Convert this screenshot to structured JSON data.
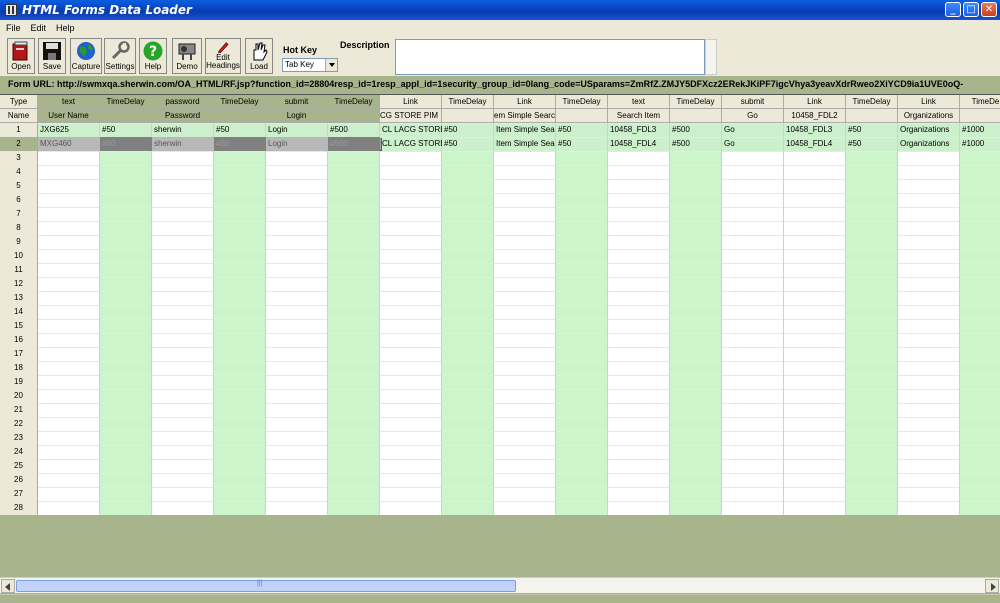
{
  "window": {
    "title": "HTML Forms Data Loader"
  },
  "menu": [
    "File",
    "Edit",
    "Help"
  ],
  "toolbar": {
    "buttons": [
      {
        "label": "Open",
        "icon": "open-book-icon"
      },
      {
        "label": "Save",
        "icon": "floppy-disk-icon"
      },
      {
        "label": "Capture",
        "icon": "globe-icon"
      },
      {
        "label": "Settings",
        "icon": "wrench-icon"
      },
      {
        "label": "Help",
        "icon": "question-icon"
      },
      {
        "label": "Demo",
        "icon": "projector-icon"
      },
      {
        "label": "Edit Headings",
        "icon": "pencil-icon"
      },
      {
        "label": "Load",
        "icon": "hand-icon"
      }
    ],
    "hotkey_label": "Hot Key",
    "hotkey_value": "Tab Key",
    "description_label": "Description",
    "description_value": ""
  },
  "form_url": "Form URL: http://swmxqa.sherwin.com/OA_HTML/RF.jsp?function_id=28804resp_id=1resp_appl_id=1security_group_id=0lang_code=USparams=ZmRfZ.ZMJY5DFXcz2ERekJKiPF7igcVhya3yeavXdrRweo2XiYCD9ia1UVE0oQ-",
  "grid": {
    "type_header": "Type",
    "name_header": "Name",
    "columns": [
      {
        "type": "text",
        "name": "User Name",
        "cells": [
          "JXG625",
          "MXG460"
        ]
      },
      {
        "type": "TimeDelay",
        "name": "",
        "cells": [
          "#50",
          "#50"
        ]
      },
      {
        "type": "password",
        "name": "Password",
        "cells": [
          "sherwin",
          "sherwin"
        ]
      },
      {
        "type": "TimeDelay",
        "name": "",
        "cells": [
          "#50",
          "#50"
        ]
      },
      {
        "type": "submit",
        "name": "Login",
        "cells": [
          "Login",
          "Login"
        ]
      },
      {
        "type": "TimeDelay",
        "name": "",
        "cells": [
          "#500",
          "#500"
        ]
      },
      {
        "type": "Link",
        "name": "CG STORE PIM I",
        "cells": [
          "CL LACG STORE",
          "CL LACG STORE"
        ]
      },
      {
        "type": "TimeDelay",
        "name": "",
        "cells": [
          "#50",
          "#50"
        ]
      },
      {
        "type": "Link",
        "name": "em Simple Searc",
        "cells": [
          "Item Simple Sea",
          "Item Simple Sea"
        ]
      },
      {
        "type": "TimeDelay",
        "name": "",
        "cells": [
          "#50",
          "#50"
        ]
      },
      {
        "type": "text",
        "name": "Search Item",
        "cells": [
          "10458_FDL3",
          "10458_FDL4"
        ]
      },
      {
        "type": "TimeDelay",
        "name": "",
        "cells": [
          "#500",
          "#500"
        ]
      },
      {
        "type": "submit",
        "name": "Go",
        "cells": [
          "Go",
          "Go"
        ]
      },
      {
        "type": "Link",
        "name": "10458_FDL2",
        "cells": [
          "10458_FDL3",
          "10458_FDL4"
        ]
      },
      {
        "type": "TimeDelay",
        "name": "",
        "cells": [
          "#50",
          "#50"
        ]
      },
      {
        "type": "Link",
        "name": "Organizations",
        "cells": [
          "Organizations",
          "Organizations"
        ]
      },
      {
        "type": "TimeDe",
        "name": "",
        "cells": [
          "#1000",
          "#1000"
        ]
      }
    ],
    "row_numbers": [
      "1",
      "2",
      "3",
      "4",
      "5",
      "6",
      "7",
      "8",
      "9",
      "10",
      "11",
      "12",
      "13",
      "14",
      "15",
      "16",
      "17",
      "18",
      "19",
      "20",
      "21",
      "22",
      "23",
      "24",
      "25",
      "26",
      "27",
      "28"
    ],
    "selected_row": 2
  }
}
